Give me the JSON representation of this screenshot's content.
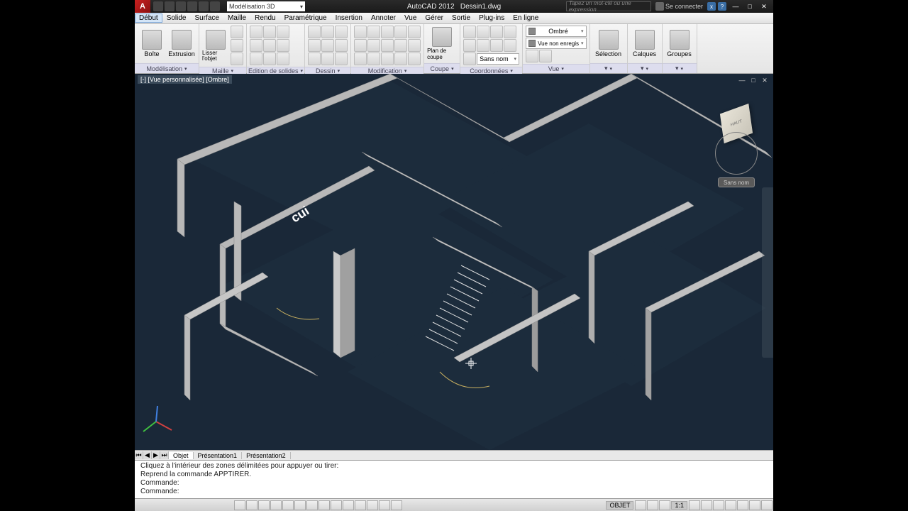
{
  "title": {
    "app": "AutoCAD 2012",
    "file": "Dessin1.dwg"
  },
  "workspace": "Modélisation 3D",
  "search_placeholder": "Tapez un mot-clé ou une expression",
  "signin": "Se connecter",
  "menus": [
    "Début",
    "Solide",
    "Surface",
    "Maille",
    "Rendu",
    "Paramétrique",
    "Insertion",
    "Annoter",
    "Vue",
    "Gérer",
    "Sortie",
    "Plug-ins",
    "En ligne"
  ],
  "ribbon": {
    "modelisation": {
      "label": "Modélisation",
      "boite": "Boîte",
      "extrusion": "Extrusion"
    },
    "maille": {
      "label": "Maille",
      "lisser": "Lisser\nl'objet"
    },
    "edition": "Edition de solides",
    "dessin": "Dessin",
    "modification": "Modification",
    "coupe": {
      "label": "Coupe",
      "plan": "Plan\nde coupe"
    },
    "coordonnees": {
      "label": "Coordonnées",
      "sansnom": "Sans nom"
    },
    "vue": {
      "label": "Vue",
      "ombre": "Ombré",
      "nonenregis": "Vue non enregis"
    },
    "selection": "Sélection",
    "calques": "Calques",
    "groupes": "Groupes"
  },
  "viewport": {
    "title": "[-] [Vue personnalisée] [Ombre]",
    "cube_face": "HAUT",
    "cube_btn": "Sans nom",
    "room_label": "cui"
  },
  "tabs": {
    "items": [
      "Objet",
      "Présentation1",
      "Présentation2"
    ]
  },
  "cmd": {
    "l1": "Cliquez à l'intérieur des zones délimitées pour appuyer ou tirer:",
    "l2": "Reprend la commande APPTIRER.",
    "l3": "Commande:",
    "l4": "Commande:"
  },
  "status": {
    "objet": "OBJET",
    "scale": "1:1",
    "dot": "▾"
  }
}
